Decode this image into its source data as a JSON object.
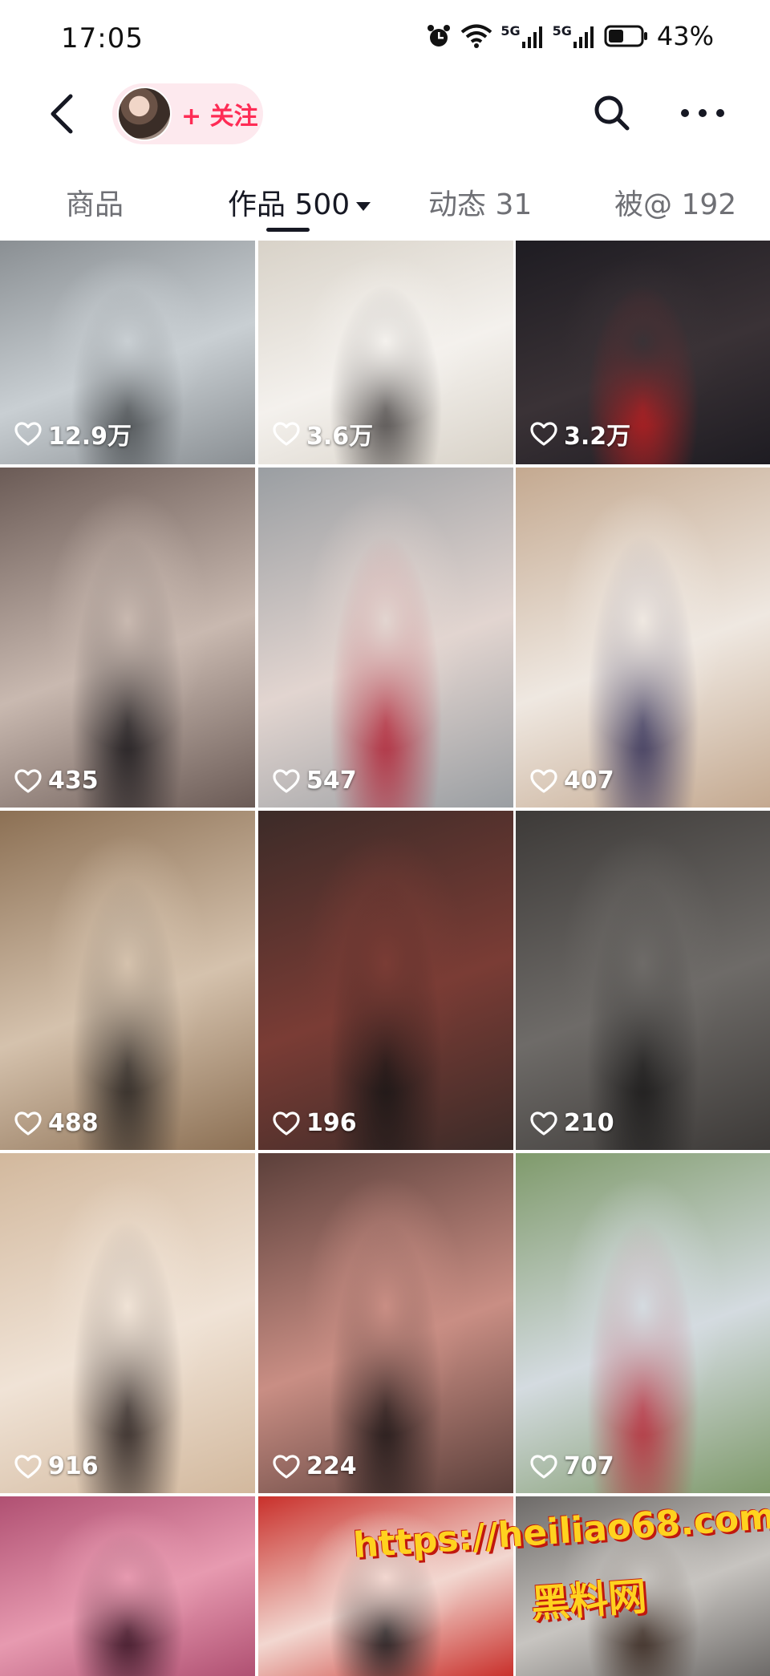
{
  "status_bar": {
    "time": "17:05",
    "network_1": "5G",
    "network_2": "5G",
    "battery": "43%",
    "icons": [
      "alarm-icon",
      "wifi-icon",
      "signal-icon",
      "signal-icon",
      "battery-icon"
    ]
  },
  "header": {
    "follow_label": "+ 关注",
    "icons": [
      "back-icon",
      "search-icon",
      "more-icon"
    ]
  },
  "tabs": [
    {
      "label": "商品",
      "active": false
    },
    {
      "label": "作品 500",
      "active": true
    },
    {
      "label": "动态 31",
      "active": false
    },
    {
      "label": "被@ 192",
      "active": false
    }
  ],
  "grid": [
    {
      "likes": "12.9万",
      "palette": [
        "#8a8f93",
        "#c9cfd3",
        "#4b4f52"
      ]
    },
    {
      "likes": "3.6万",
      "palette": [
        "#d8d2c8",
        "#f4f1ed",
        "#4f4b4a"
      ]
    },
    {
      "likes": "3.2万",
      "palette": [
        "#1e1c22",
        "#3a3236",
        "#b31f22"
      ]
    },
    {
      "likes": "435",
      "palette": [
        "#6b5b56",
        "#c9b9b0",
        "#1d1a1d"
      ]
    },
    {
      "likes": "547",
      "palette": [
        "#9a9ea2",
        "#e2d5d0",
        "#b0283a"
      ]
    },
    {
      "likes": "407",
      "palette": [
        "#c4a990",
        "#efe8e1",
        "#39355a"
      ]
    },
    {
      "likes": "488",
      "palette": [
        "#8c7054",
        "#d5c2ad",
        "#2a2522"
      ]
    },
    {
      "likes": "196",
      "palette": [
        "#3c2b28",
        "#7a3c35",
        "#1a1616"
      ]
    },
    {
      "likes": "210",
      "palette": [
        "#3d3a38",
        "#6e6b68",
        "#1c1b1b"
      ]
    },
    {
      "likes": "916",
      "palette": [
        "#d2b89d",
        "#f0e3d6",
        "#2c2321"
      ]
    },
    {
      "likes": "224",
      "palette": [
        "#5b3f3a",
        "#c98e84",
        "#1f1717"
      ]
    },
    {
      "likes": "707",
      "palette": [
        "#7f9a6b",
        "#d4dbe0",
        "#b5303d"
      ]
    },
    {
      "likes": "",
      "palette": [
        "#b05072",
        "#e79ab0",
        "#3b1626"
      ]
    },
    {
      "likes": "",
      "palette": [
        "#c9302b",
        "#f2d7d0",
        "#1e1c1e"
      ]
    },
    {
      "likes": "",
      "palette": [
        "#6d6a68",
        "#c7c4c0",
        "#3a2a22"
      ]
    }
  ],
  "watermark": {
    "url": "https://heiliao68.com",
    "name": "黑料网"
  }
}
